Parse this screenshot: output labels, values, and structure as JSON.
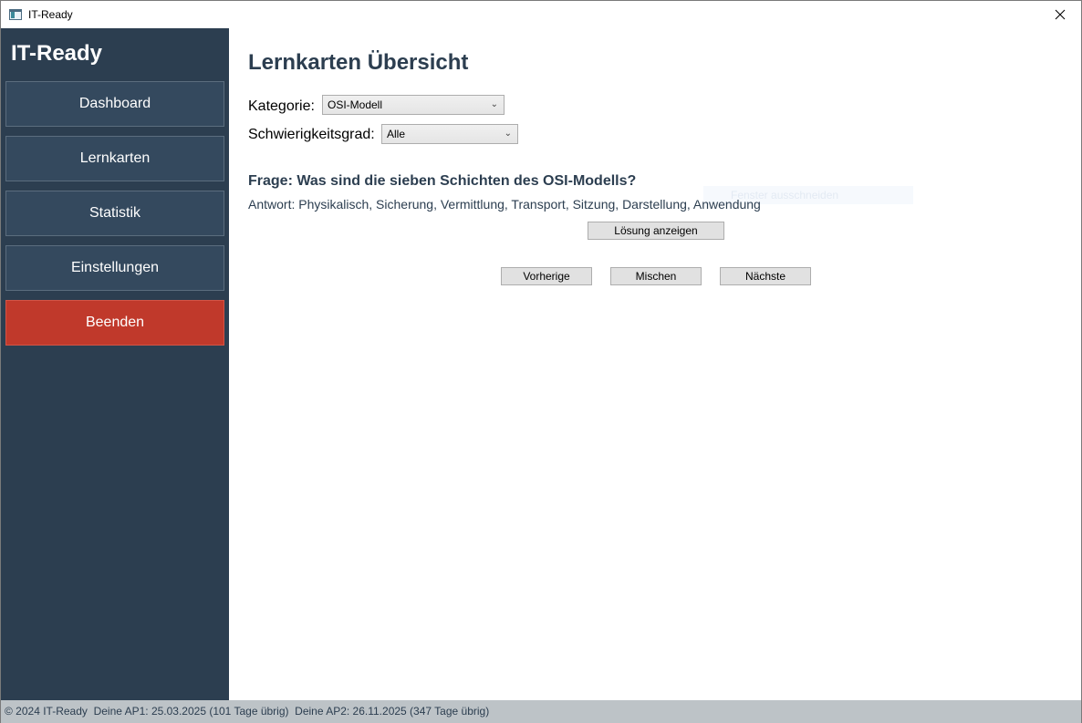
{
  "window": {
    "title": "IT-Ready"
  },
  "sidebar": {
    "brand": "IT-Ready",
    "items": [
      {
        "label": "Dashboard"
      },
      {
        "label": "Lernkarten"
      },
      {
        "label": "Statistik"
      },
      {
        "label": "Einstellungen"
      },
      {
        "label": "Beenden"
      }
    ]
  },
  "main": {
    "title": "Lernkarten Übersicht",
    "category_label": "Kategorie:",
    "category_value": "OSI-Modell",
    "difficulty_label": "Schwierigkeitsgrad:",
    "difficulty_value": "Alle",
    "question": "Frage: Was sind die sieben Schichten des OSI-Modells?",
    "answer": "Antwort: Physikalisch, Sicherung, Vermittlung, Transport, Sitzung, Darstellung, Anwendung",
    "ghost_text": "Fenster ausschneiden",
    "show_solution": "Lösung anzeigen",
    "prev": "Vorherige",
    "shuffle": "Mischen",
    "next": "Nächste"
  },
  "status": {
    "copyright": "© 2024 IT-Ready",
    "ap1": "Deine AP1: 25.03.2025 (101 Tage übrig)",
    "ap2": "Deine AP2: 26.11.2025 (347 Tage übrig)"
  },
  "colors": {
    "sidebar_bg": "#2c3e50",
    "nav_bg": "#34495e",
    "danger": "#c0392b",
    "statusbar_bg": "#bdc3c7"
  }
}
